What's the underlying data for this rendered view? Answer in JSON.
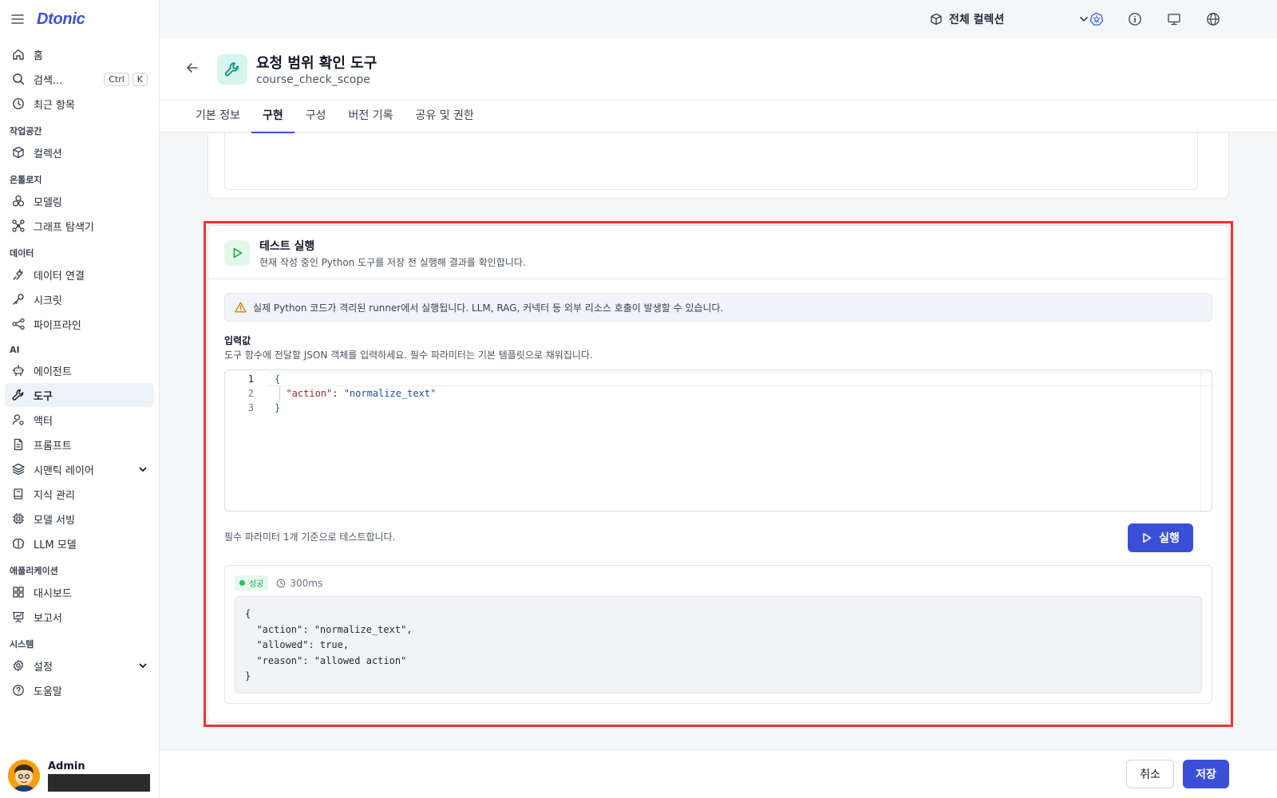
{
  "brand": "Dtonic",
  "topbar": {
    "collection_label": "전체 컬렉션",
    "icons": [
      "kubernetes-icon",
      "info-icon",
      "monitor-icon",
      "globe-icon"
    ]
  },
  "sidebar": {
    "home": "홈",
    "search": "검색...",
    "shortcut_ctrl": "Ctrl",
    "shortcut_k": "K",
    "recent": "최근 항목",
    "sections": {
      "workspace": "작업공간",
      "ontology": "온톨로지",
      "data": "데이터",
      "ai": "AI",
      "application": "애플리케이션",
      "system": "시스템"
    },
    "collection": "컬렉션",
    "modeling": "모델링",
    "graph_explorer": "그래프 탐색기",
    "data_connection": "데이터 연결",
    "secret": "시크릿",
    "pipeline": "파이프라인",
    "agent": "에이전트",
    "tool": "도구",
    "actor": "액터",
    "prompt": "프롬프트",
    "semantic_layer": "시맨틱 레이어",
    "knowledge": "지식 관리",
    "model_serving": "모델 서빙",
    "llm_model": "LLM 모델",
    "dashboard": "대시보드",
    "report": "보고서",
    "settings": "설정",
    "help": "도움말",
    "user_name": "Admin"
  },
  "header": {
    "title": "요청 범위 확인 도구",
    "subtitle": "course_check_scope"
  },
  "tabs": [
    {
      "label": "기본 정보"
    },
    {
      "label": "구현"
    },
    {
      "label": "구성"
    },
    {
      "label": "버전 기록"
    },
    {
      "label": "공유 및 권한"
    }
  ],
  "test": {
    "title": "테스트 실행",
    "description": "현재 작성 중인 Python 도구를 저장 전 실행해 결과를 확인합니다.",
    "warning": "실제 Python 코드가 격리된 runner에서 실행됩니다. LLM, RAG, 커넥터 등 외부 리소스 호출이 발생할 수 있습니다.",
    "input_label": "입력값",
    "input_description": "도구 함수에 전달할 JSON 객체를 입력하세요. 필수 파라미터는 기본 템플릿으로 채워집니다.",
    "editor": {
      "line_numbers": [
        "1",
        "2",
        "3"
      ],
      "open_brace": "{",
      "key": "\"action\"",
      "colon": ": ",
      "value": "\"normalize_text\"",
      "close_brace": "}"
    },
    "required_note": "필수 파라미터 1개 기준으로 테스트합니다.",
    "run_label": "실행",
    "status": "성공",
    "duration": "300ms",
    "result": "{\n  \"action\": \"normalize_text\",\n  \"allowed\": true,\n  \"reason\": \"allowed action\"\n}"
  },
  "footer": {
    "cancel": "취소",
    "save": "저장"
  },
  "colors": {
    "accent": "#3b4fd6",
    "success": "#22c55e",
    "highlight": "#e33333"
  }
}
